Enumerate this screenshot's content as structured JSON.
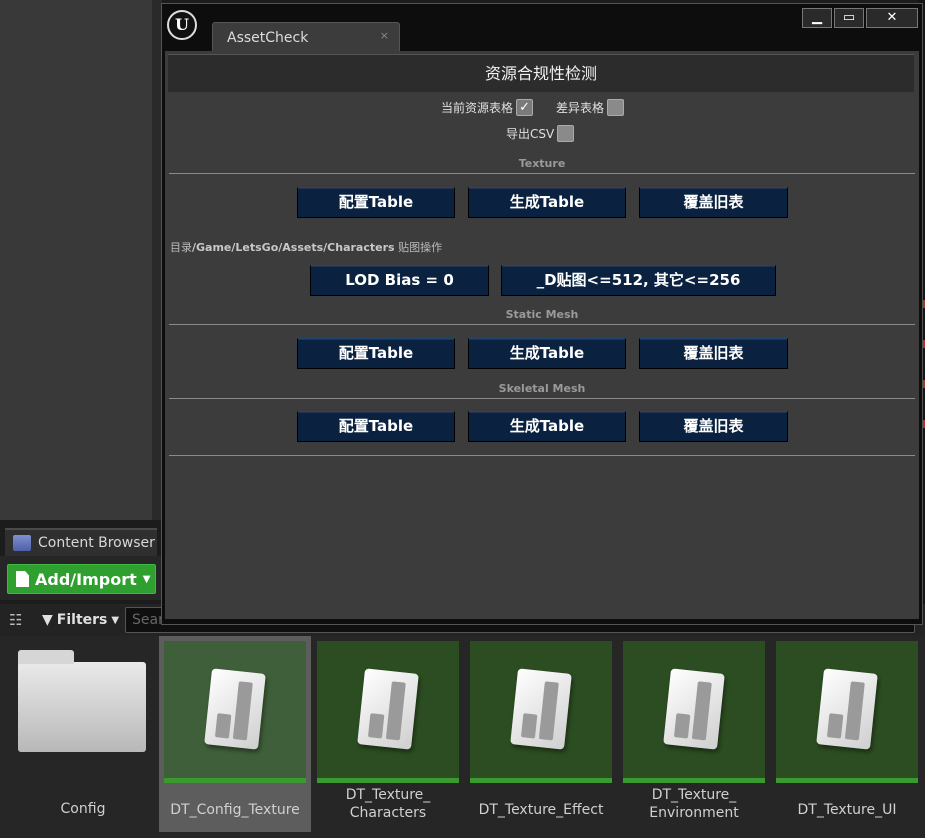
{
  "window": {
    "logo_text": "U",
    "tab_title": "AssetCheck",
    "tab_close": "×",
    "controls": {
      "minimize": "▁",
      "maximize": "▭",
      "close": "✕"
    }
  },
  "panel": {
    "header": "资源合规性检测",
    "options": {
      "current_table_label": "当前资源表格",
      "current_table_checked": true,
      "diff_table_label": "差异表格",
      "diff_table_checked": false,
      "export_csv_label": "导出CSV",
      "export_csv_checked": false
    },
    "sections": {
      "texture": "Texture",
      "static_mesh": "Static Mesh",
      "skeletal_mesh": "Skeletal Mesh"
    },
    "buttons": {
      "config_table": "配置Table",
      "generate_table": "生成Table",
      "overwrite_old": "覆盖旧表",
      "lod_bias": "LOD Bias = 0",
      "d_texture_limit": "_D贴图<=512, 其它<=256"
    },
    "directory_prefix": "目录",
    "directory_path": "/Game/LetsGo/Assets/Characters",
    "directory_suffix": " 贴图操作"
  },
  "content_browser": {
    "tab_label": "Content Browser",
    "add_import": "Add/Import",
    "filters": "Filters",
    "search_placeholder": "Sear",
    "assets": [
      {
        "name": "Config",
        "type": "folder"
      },
      {
        "name": "DT_Config_Texture",
        "type": "datatable",
        "selected": true
      },
      {
        "name": "DT_Texture_\nCharacters",
        "type": "datatable"
      },
      {
        "name": "DT_Texture_Effect",
        "type": "datatable"
      },
      {
        "name": "DT_Texture_\nEnvironment",
        "type": "datatable"
      },
      {
        "name": "DT_Texture_UI",
        "type": "datatable"
      }
    ]
  },
  "colors": {
    "button_bg": "#0a2240",
    "thumb_bg": "#2c4d22",
    "add_import_green": "#2f9f2f"
  }
}
